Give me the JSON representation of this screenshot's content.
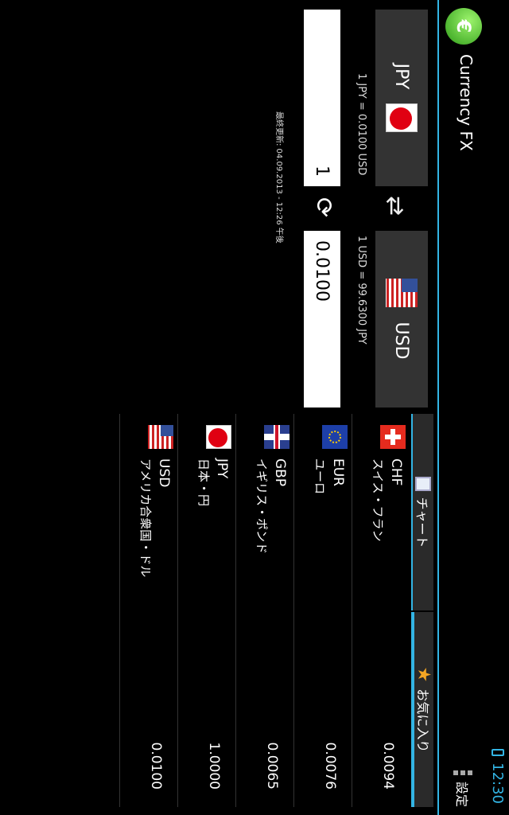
{
  "status": {
    "time": "12:30"
  },
  "app": {
    "title": "Currency FX",
    "settings_label": "設定"
  },
  "converter": {
    "from_code": "JPY",
    "to_code": "USD",
    "from_rate": "1 JPY = 0.0100 USD",
    "to_rate": "1 USD = 99.6300 JPY",
    "from_amount": "1",
    "to_amount": "0.0100",
    "last_updated": "最終更新: 04.09.2013 - 12:26 午後"
  },
  "tabs": [
    {
      "label": "チャート"
    },
    {
      "label": "お気に入り"
    }
  ],
  "favorites": [
    {
      "code": "CHF",
      "name": "スイス・フラン",
      "value": "0.0094",
      "flag": "flag-switzerland"
    },
    {
      "code": "EUR",
      "name": "ユーロ",
      "value": "0.0076",
      "flag": "flag-eu"
    },
    {
      "code": "GBP",
      "name": "イギリス・ポンド",
      "value": "0.0065",
      "flag": "flag-uk"
    },
    {
      "code": "JPY",
      "name": "日本・円",
      "value": "1.0000",
      "flag": "flag-japan"
    },
    {
      "code": "USD",
      "name": "アメリカ合衆国・ドル",
      "value": "0.0100",
      "flag": "flag-usa"
    }
  ],
  "colors": {
    "accent": "#33b5e5",
    "button": "#333333",
    "background": "#000000"
  }
}
